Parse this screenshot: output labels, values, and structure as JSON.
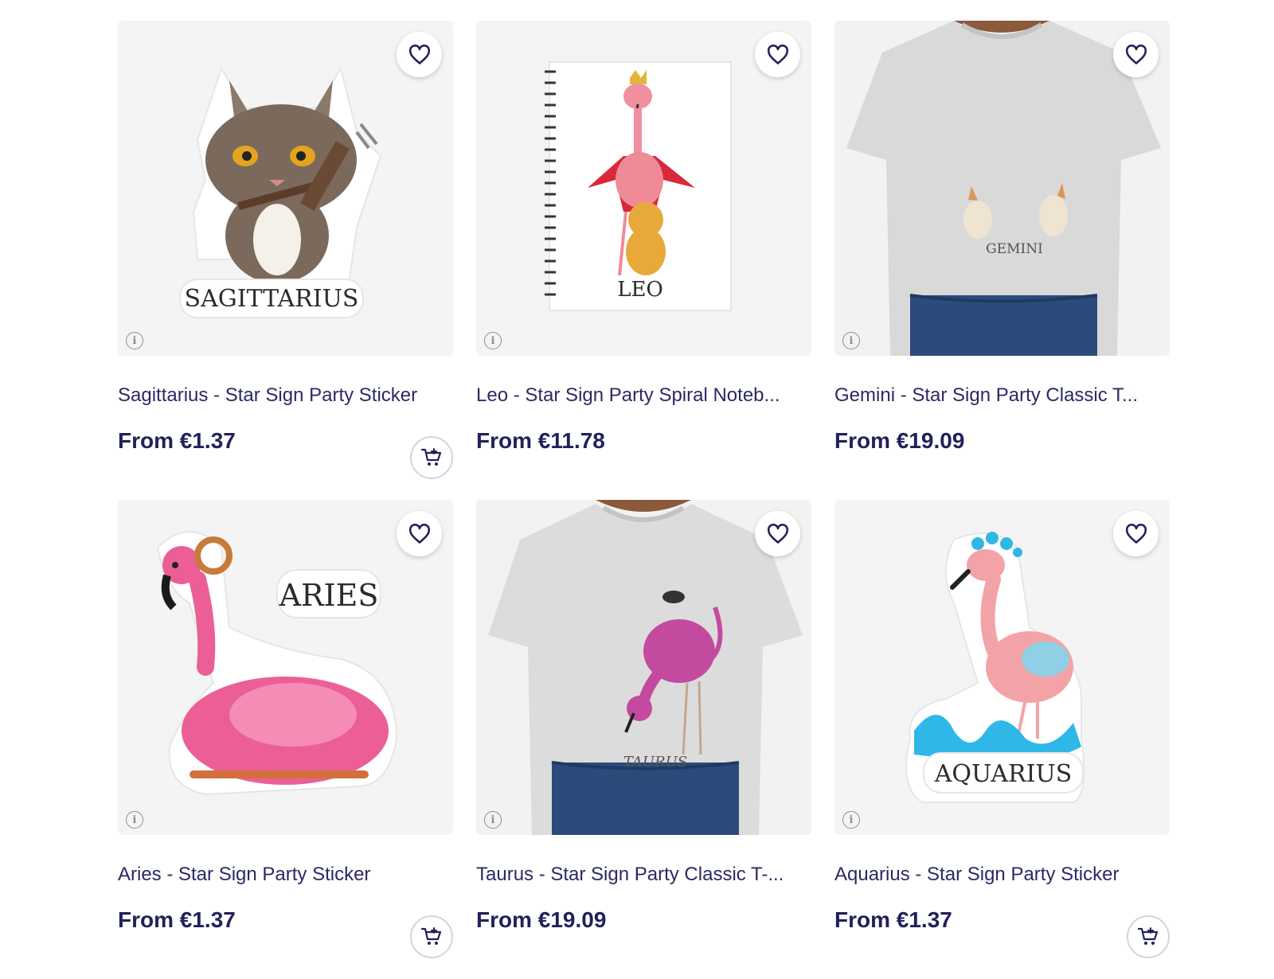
{
  "products": [
    {
      "title": "Sagittarius - Star Sign Party Sticker",
      "price": "From €1.37",
      "art_text": "SAGITTARIUS",
      "has_cart": true
    },
    {
      "title": "Leo - Star Sign Party Spiral Noteb...",
      "price": "From €11.78",
      "art_text": "LEO",
      "has_cart": false
    },
    {
      "title": "Gemini - Star Sign Party Classic T...",
      "price": "From €19.09",
      "art_text": "GEMINI",
      "has_cart": false
    },
    {
      "title": "Aries - Star Sign Party Sticker",
      "price": "From €1.37",
      "art_text": "ARIES",
      "has_cart": true
    },
    {
      "title": "Taurus - Star Sign Party Classic T-...",
      "price": "From €19.09",
      "art_text": "TAURUS",
      "has_cart": false
    },
    {
      "title": "Aquarius - Star Sign Party Sticker",
      "price": "From €1.37",
      "art_text": "AQUARIUS",
      "has_cart": true
    }
  ],
  "icons": {
    "favorite": "heart-icon",
    "info": "info-icon",
    "add_to_cart": "cart-add-icon"
  },
  "colors": {
    "text": "#22215b",
    "thumb_bg": "#f4f4f4",
    "flamingo": "#ef6fa6"
  }
}
